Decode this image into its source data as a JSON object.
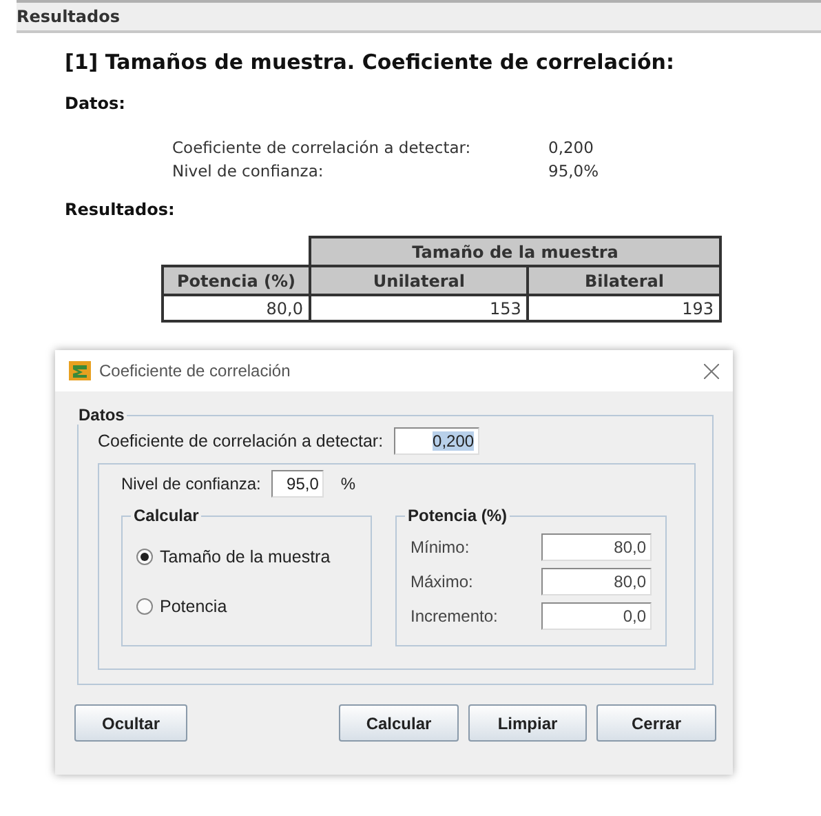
{
  "panel_title": "Resultados",
  "report": {
    "heading": "[1] Tamaños de muestra. Coeficiente de correlación:",
    "datos_title": "Datos:",
    "datos": [
      {
        "label": "Coeficiente de correlación a detectar:",
        "value": "0,200"
      },
      {
        "label": "Nivel de confianza:",
        "value": "95,0%"
      }
    ],
    "resultados_title": "Resultados:",
    "table": {
      "group_header": "Tamaño de la muestra",
      "columns": [
        "Potencia (%)",
        "Unilateral",
        "Bilateral"
      ],
      "rows": [
        [
          "80,0",
          "153",
          "193"
        ]
      ]
    }
  },
  "dialog": {
    "title": "Coeficiente de correlación",
    "datos_legend": "Datos",
    "coef_label": "Coeficiente de correlación a detectar:",
    "coef_value": "0,200",
    "nivel_label": "Nivel de confianza:",
    "nivel_value": "95,0",
    "nivel_unit": "%",
    "calcular_legend": "Calcular",
    "options": [
      {
        "label": "Tamaño de la muestra",
        "selected": true
      },
      {
        "label": "Potencia",
        "selected": false
      }
    ],
    "potencia_legend": "Potencia (%)",
    "potencia_fields": [
      {
        "label": "Mínimo:",
        "value": "80,0"
      },
      {
        "label": "Máximo:",
        "value": "80,0"
      },
      {
        "label": "Incremento:",
        "value": "0,0"
      }
    ],
    "buttons": [
      "Ocultar",
      "Calcular",
      "Limpiar",
      "Cerrar"
    ]
  }
}
